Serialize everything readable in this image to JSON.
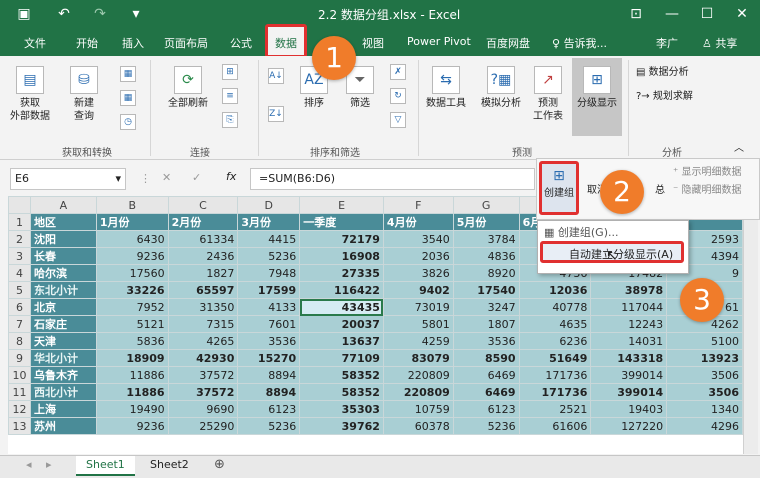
{
  "window": {
    "title": "2.2 数据分组.xlsx - Excel"
  },
  "tabs": [
    "文件",
    "开始",
    "插入",
    "页面布局",
    "公式",
    "数据",
    "审阅",
    "视图",
    "Power Pivot",
    "百度网盘"
  ],
  "tab_labels": {
    "review_partial": "",
    "view": "视图",
    "powerpivot": "Power Pivot",
    "baidu": "百度网盘"
  },
  "tell_me": "告诉我...",
  "user": "李广",
  "share": "共享",
  "ribbon": {
    "get_external": "获取\n外部数据",
    "new_query": "新建\n查询",
    "group_get": "获取和转换",
    "refresh_all": "全部刷新",
    "group_conn": "连接",
    "sort": "排序",
    "filter": "筛选",
    "group_sort": "排序和筛选",
    "data_tools": "数据工具",
    "what_if": "模拟分析",
    "forecast": "预测\n工作表",
    "group_forecast": "预测",
    "outline": "分级显示",
    "data_analysis": "数据分析",
    "solver": "规划求解",
    "group_analysis": "分析"
  },
  "formula_bar": {
    "cell": "E6",
    "formula": "=SUM(B6:D6)"
  },
  "subpanel": {
    "group": "创建组",
    "ungroup_partial": "取消组",
    "subtotal_partial": "总",
    "show_detail": "显示明细数据",
    "hide_detail": "隐藏明细数据"
  },
  "menu": {
    "item1": "创建组(G)...",
    "item2": "自动建立分级显示(A)"
  },
  "badges": [
    "1",
    "2",
    "3"
  ],
  "columns": [
    "A",
    "B",
    "C",
    "D",
    "E",
    "F",
    "G",
    "H",
    "I",
    "J"
  ],
  "headers": [
    "地区",
    "1月份",
    "2月份",
    "3月份",
    "一季度",
    "4月份",
    "5月份",
    "6月",
    "",
    ""
  ],
  "rows": [
    {
      "n": "2",
      "cells": [
        "沈阳",
        "6430",
        "61334",
        "4415",
        "72179",
        "3540",
        "3784",
        "",
        "",
        "2593"
      ],
      "bold": false
    },
    {
      "n": "3",
      "cells": [
        "长春",
        "9236",
        "2436",
        "5236",
        "16908",
        "2036",
        "4836",
        "",
        "",
        "4394"
      ],
      "bold": false
    },
    {
      "n": "4",
      "cells": [
        "哈尔滨",
        "17560",
        "1827",
        "7948",
        "27335",
        "3826",
        "8920",
        "4736",
        "17482",
        "9"
      ],
      "bold": false
    },
    {
      "n": "5",
      "cells": [
        "东北小计",
        "33226",
        "65597",
        "17599",
        "116422",
        "9402",
        "17540",
        "12036",
        "38978",
        ""
      ],
      "bold": true
    },
    {
      "n": "6",
      "cells": [
        "北京",
        "7952",
        "31350",
        "4133",
        "43435",
        "73019",
        "3247",
        "40778",
        "117044",
        "61"
      ],
      "bold": false
    },
    {
      "n": "7",
      "cells": [
        "石家庄",
        "5121",
        "7315",
        "7601",
        "20037",
        "5801",
        "1807",
        "4635",
        "12243",
        "4262"
      ],
      "bold": false
    },
    {
      "n": "8",
      "cells": [
        "天津",
        "5836",
        "4265",
        "3536",
        "13637",
        "4259",
        "3536",
        "6236",
        "14031",
        "5100"
      ],
      "bold": false
    },
    {
      "n": "9",
      "cells": [
        "华北小计",
        "18909",
        "42930",
        "15270",
        "77109",
        "83079",
        "8590",
        "51649",
        "143318",
        "13923"
      ],
      "bold": true
    },
    {
      "n": "10",
      "cells": [
        "乌鲁木齐",
        "11886",
        "37572",
        "8894",
        "58352",
        "220809",
        "6469",
        "171736",
        "399014",
        "3506"
      ],
      "bold": false
    },
    {
      "n": "11",
      "cells": [
        "西北小计",
        "11886",
        "37572",
        "8894",
        "58352",
        "220809",
        "6469",
        "171736",
        "399014",
        "3506"
      ],
      "bold": true
    },
    {
      "n": "12",
      "cells": [
        "上海",
        "19490",
        "9690",
        "6123",
        "35303",
        "10759",
        "6123",
        "2521",
        "19403",
        "1340"
      ],
      "bold": false
    },
    {
      "n": "13",
      "cells": [
        "苏州",
        "9236",
        "25290",
        "5236",
        "39762",
        "60378",
        "5236",
        "61606",
        "127220",
        "4296"
      ],
      "bold": false
    }
  ],
  "sheets": [
    "Sheet1",
    "Sheet2"
  ]
}
